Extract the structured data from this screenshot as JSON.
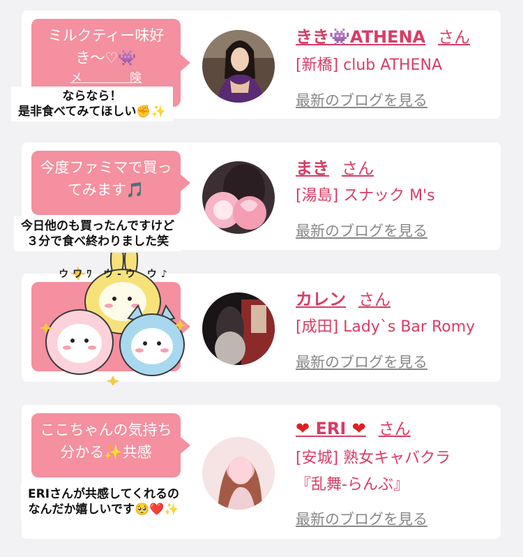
{
  "cards": [
    {
      "bubble": "ミルクティー味好き〜♡👾",
      "bubble_sub": "メ　　　　険",
      "name": "きき👾ATHENA",
      "san": "さん",
      "shop": "[新橋] club ATHENA",
      "blog": "最新のブログを見る",
      "note_lines": [
        "ならなら！",
        "是非食べてみてほしい✊✨"
      ]
    },
    {
      "bubble": "今度ファミマで買ってみます🎵",
      "name": "まき",
      "san": "さん",
      "shop": "[湯島] スナック M's",
      "blog": "最新のブログを見る",
      "note_lines": [
        "今日他のも買ったんですけど",
        "３分で食べ終わりました笑"
      ]
    },
    {
      "bubble": "",
      "name": "カレン",
      "san": "さん",
      "shop": "[成田] Lady`s Bar Romy",
      "blog": "最新のブログを見る",
      "sticker_text": "ウワﾜ ウ-ウ ウ♪"
    },
    {
      "bubble": "ここちゃんの気持ち分かる✨共感",
      "name_heart": "❤",
      "name": "ERI",
      "san": "さん",
      "shop": "[安城] 熟女キャバクラ",
      "shop2": "『乱舞-らんぶ』",
      "blog": "最新のブログを見る",
      "note_lines": [
        "ERIさんが共感してくれるの",
        "なんだか嬉しいです🥺❤️✨"
      ]
    }
  ],
  "colors": {
    "accent": "#d93c64",
    "bubble": "#f4909f",
    "link": "#888888"
  }
}
